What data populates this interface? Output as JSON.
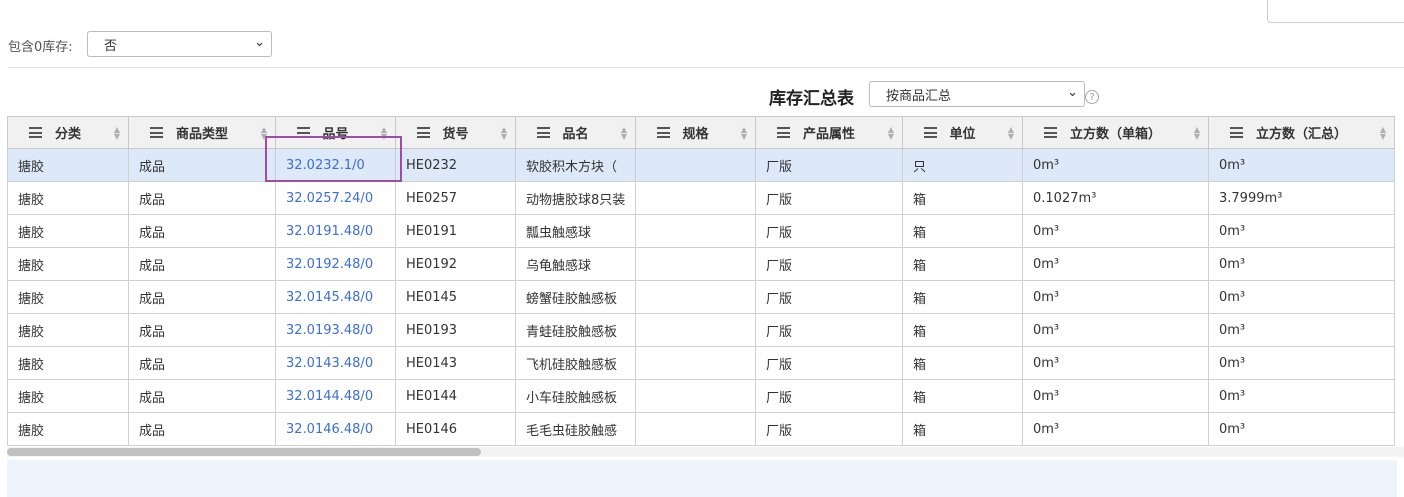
{
  "filter": {
    "include_zero_label": "包含0库存:",
    "include_zero_value": "否"
  },
  "report": {
    "title": "库存汇总表",
    "mode_value": "按商品汇总",
    "help_symbol": "?"
  },
  "columns": [
    "分类",
    "商品类型",
    "品号",
    "货号",
    "品名",
    "规格",
    "产品属性",
    "单位",
    "立方数（单箱）",
    "立方数（汇总）"
  ],
  "rows": [
    [
      "搪胶",
      "成品",
      "32.0232.1/0",
      "HE0232",
      "软胶积木方块（",
      "",
      "厂版",
      "只",
      "0m³",
      "0m³"
    ],
    [
      "搪胶",
      "成品",
      "32.0257.24/0",
      "HE0257",
      "动物搪胶球8只装",
      "",
      "厂版",
      "箱",
      "0.1027m³",
      "3.7999m³"
    ],
    [
      "搪胶",
      "成品",
      "32.0191.48/0",
      "HE0191",
      "瓢虫触感球",
      "",
      "厂版",
      "箱",
      "0m³",
      "0m³"
    ],
    [
      "搪胶",
      "成品",
      "32.0192.48/0",
      "HE0192",
      "乌龟触感球",
      "",
      "厂版",
      "箱",
      "0m³",
      "0m³"
    ],
    [
      "搪胶",
      "成品",
      "32.0145.48/0",
      "HE0145",
      "螃蟹硅胶触感板",
      "",
      "厂版",
      "箱",
      "0m³",
      "0m³"
    ],
    [
      "搪胶",
      "成品",
      "32.0193.48/0",
      "HE0193",
      "青蛙硅胶触感板",
      "",
      "厂版",
      "箱",
      "0m³",
      "0m³"
    ],
    [
      "搪胶",
      "成品",
      "32.0143.48/0",
      "HE0143",
      "飞机硅胶触感板",
      "",
      "厂版",
      "箱",
      "0m³",
      "0m³"
    ],
    [
      "搪胶",
      "成品",
      "32.0144.48/0",
      "HE0144",
      "小车硅胶触感板",
      "",
      "厂版",
      "箱",
      "0m³",
      "0m³"
    ],
    [
      "搪胶",
      "成品",
      "32.0146.48/0",
      "HE0146",
      "毛毛虫硅胶触感",
      "",
      "厂版",
      "箱",
      "0m³",
      "0m³"
    ]
  ],
  "colors": {
    "link": "#3b6fd4",
    "selected_row": "#dde8f8",
    "highlight_border": "#9b4ea3",
    "header_bg": "#f1f1f1"
  }
}
